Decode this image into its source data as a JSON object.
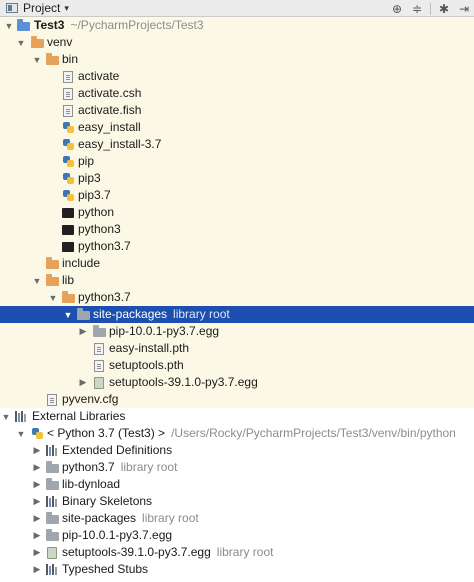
{
  "toolbar": {
    "project_label": "Project",
    "caret": "▾",
    "buttons": [
      {
        "icon": "target-icon",
        "glyph": "⊕"
      },
      {
        "icon": "collapse-icon",
        "glyph": "≑"
      },
      {
        "icon": "gear-icon",
        "glyph": "✱"
      },
      {
        "icon": "hide-icon",
        "glyph": "⇥"
      }
    ]
  },
  "tree": {
    "rows": [
      {
        "name": "Test3",
        "secondary": "~/PycharmProjects/Test3"
      },
      {
        "name": "venv"
      },
      {
        "name": "bin"
      },
      {
        "name": "activate"
      },
      {
        "name": "activate.csh"
      },
      {
        "name": "activate.fish"
      },
      {
        "name": "easy_install"
      },
      {
        "name": "easy_install-3.7"
      },
      {
        "name": "pip"
      },
      {
        "name": "pip3"
      },
      {
        "name": "pip3.7"
      },
      {
        "name": "python"
      },
      {
        "name": "python3"
      },
      {
        "name": "python3.7"
      },
      {
        "name": "include"
      },
      {
        "name": "lib"
      },
      {
        "name": "python3.7"
      },
      {
        "name": "site-packages",
        "secondary": "library root"
      },
      {
        "name": "pip-10.0.1-py3.7.egg"
      },
      {
        "name": "easy-install.pth"
      },
      {
        "name": "setuptools.pth"
      },
      {
        "name": "setuptools-39.1.0-py3.7.egg"
      },
      {
        "name": "pyvenv.cfg"
      },
      {
        "name": "External Libraries"
      },
      {
        "name": "< Python 3.7 (Test3) >",
        "secondary": "/Users/Rocky/PycharmProjects/Test3/venv/bin/python"
      },
      {
        "name": "Extended Definitions"
      },
      {
        "name": "python3.7",
        "secondary": "library root"
      },
      {
        "name": "lib-dynload"
      },
      {
        "name": "Binary Skeletons"
      },
      {
        "name": "site-packages",
        "secondary": "library root"
      },
      {
        "name": "pip-10.0.1-py3.7.egg"
      },
      {
        "name": "setuptools-39.1.0-py3.7.egg",
        "secondary": "library root"
      },
      {
        "name": "Typeshed Stubs"
      }
    ]
  }
}
